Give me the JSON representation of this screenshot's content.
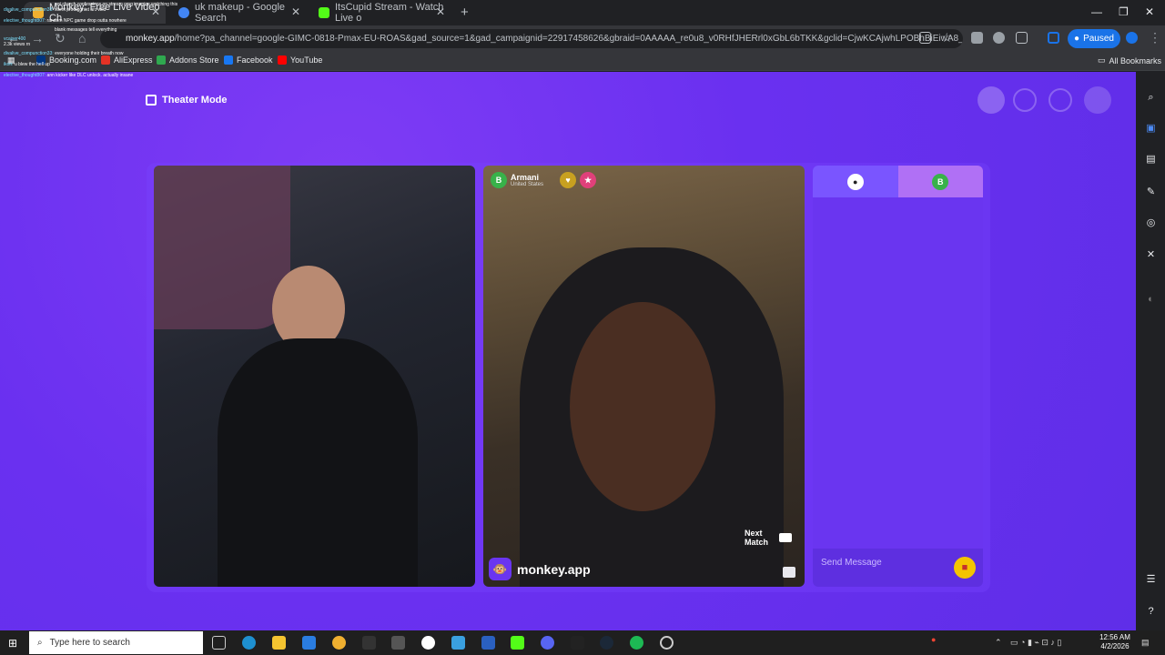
{
  "browser": {
    "tabs": [
      {
        "title": "Monkey: Free Live Video Ch",
        "active": true,
        "favicon_color": "#f0b030"
      },
      {
        "title": "uk makeup - Google Search",
        "active": false,
        "favicon_color": "#4285f4"
      },
      {
        "title": "ItsCupid Stream - Watch Live o",
        "active": false,
        "favicon_color": "#53fc18"
      }
    ],
    "url_host": "monkey.app",
    "url_rest": "/home?pa_channel=google-GIMC-0818-Pmax-EU-ROAS&gad_source=1&gad_campaignid=22917458626&gbraid=0AAAAA_re0u8_v0RHfJHERrl0xGbL6bTKK&gclid=CjwKCAjwhLPOBhBiEiwA8_wJH...",
    "profile_status": "Paused",
    "bookmarks": [
      "Booking.com",
      "AliExpress",
      "Addons Store",
      "Facebook",
      "YouTube"
    ],
    "all_bookmarks": "All Bookmarks"
  },
  "overlay_chat": [
    {
      "user": "",
      "text": "not church confessions on stream omg imagine watching this"
    },
    {
      "user": "divalive_compunction33:",
      "text": "silent protagonist arc wild"
    },
    {
      "user": "elective_thought807:",
      "text": "random NPC game drop outta nowhere"
    },
    {
      "user": "",
      "text": "blank messages tell everything"
    },
    {
      "user": "vcaiser400",
      "text": ""
    },
    {
      "user": "",
      "text": "2.3k views rn"
    },
    {
      "user": "divalive_compunction33:",
      "text": "everyone holding their breath now"
    },
    {
      "user": "ikon:",
      "text": "u blew the hell up"
    },
    {
      "user": "elective_thought807:",
      "text": "ann kicker like DLC unlock. actually insane"
    }
  ],
  "page": {
    "theater_mode": "Theater Mode",
    "partner": {
      "initial": "B",
      "name": "Armani",
      "country": "United States"
    },
    "next_match": "Next Match",
    "brand": "monkey.app",
    "chat_partner_initial": "B",
    "send_message_placeholder": "Send Message"
  },
  "taskbar": {
    "search_placeholder": "Type here to search",
    "time": "12:56 AM",
    "date": "4/2/2026"
  },
  "colors": {
    "page_bg": "#6a30f0",
    "accent_blue": "#1a73e8",
    "gift": "#f4c400"
  }
}
